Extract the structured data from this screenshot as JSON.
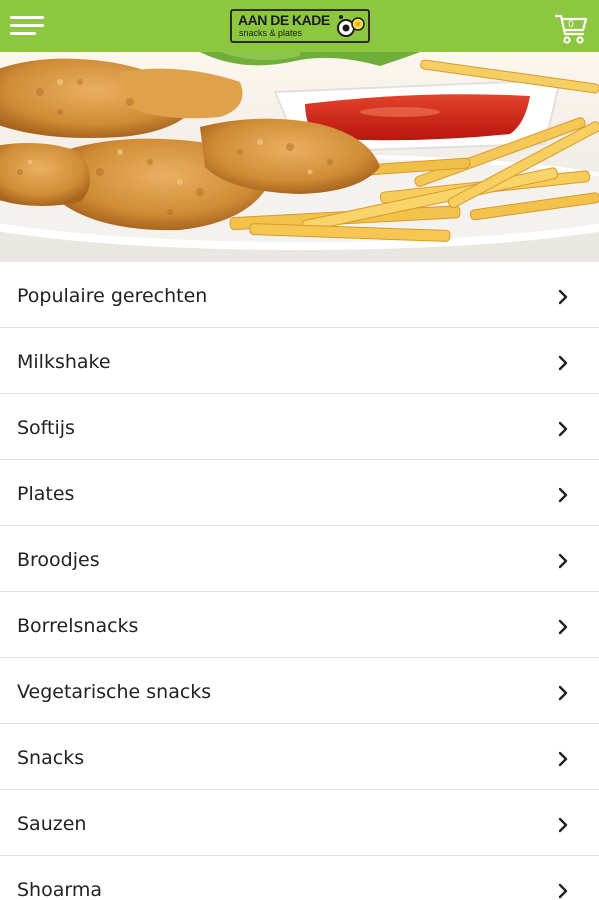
{
  "header": {
    "background_color": "#8dc63f",
    "menu_icon": "hamburger-menu-icon",
    "logo": {
      "title": "AAN DE KADE",
      "subtitle": "snacks & plates"
    },
    "cart": {
      "icon": "shopping-cart-icon",
      "count": "0"
    }
  },
  "hero": {
    "image": "fried-chicken-fries-ketchup-plate"
  },
  "categories": [
    {
      "label": "Populaire gerechten"
    },
    {
      "label": "Milkshake"
    },
    {
      "label": "Softijs"
    },
    {
      "label": "Plates"
    },
    {
      "label": "Broodjes"
    },
    {
      "label": "Borrelsnacks"
    },
    {
      "label": "Vegetarische snacks"
    },
    {
      "label": "Snacks"
    },
    {
      "label": "Sauzen"
    },
    {
      "label": "Shoarma"
    }
  ],
  "chevron_icon": "chevron-right-icon"
}
